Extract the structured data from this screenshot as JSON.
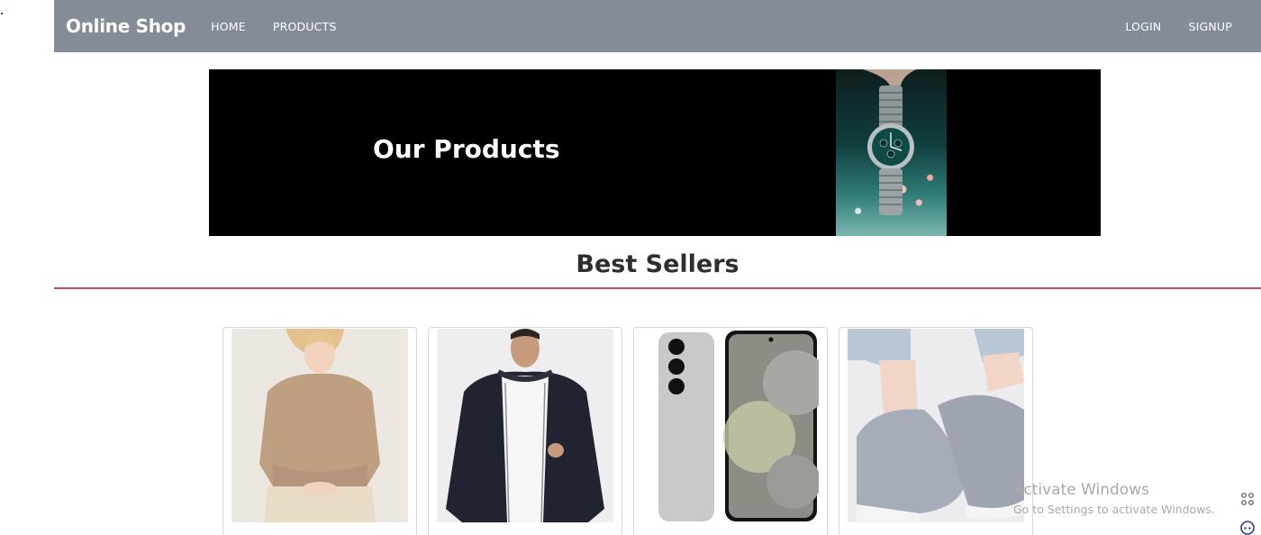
{
  "navbar": {
    "brand": "Online Shop",
    "links_left": [
      {
        "label": "HOME"
      },
      {
        "label": "PRODUCTS"
      }
    ],
    "links_right": [
      {
        "label": "LOGIN"
      },
      {
        "label": "SIGNUP"
      }
    ]
  },
  "banner": {
    "title": "Our Products",
    "image_icon": "watch-photo"
  },
  "section": {
    "title": "Best Sellers"
  },
  "products": [
    {
      "image_icon": "beige-sweater-photo"
    },
    {
      "image_icon": "black-hoodie-photo"
    },
    {
      "image_icon": "smartphone-photo"
    },
    {
      "image_icon": "knit-sneakers-photo"
    }
  ],
  "watermark": {
    "title": "Activate Windows",
    "subtitle": "Go to Settings to activate Windows."
  },
  "colors": {
    "navbar": "#848c97",
    "accent_rule": "#c94a5a",
    "banner_bg": "#000000"
  }
}
